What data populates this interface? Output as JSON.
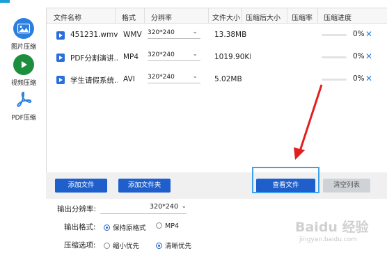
{
  "sidebar": {
    "items": [
      {
        "label": "图片压缩",
        "icon": "image-icon"
      },
      {
        "label": "视频压缩",
        "icon": "video-play-icon"
      },
      {
        "label": "PDF压缩",
        "icon": "pdf-icon"
      }
    ]
  },
  "table": {
    "headers": [
      "文件名称",
      "格式",
      "分辨率",
      "文件大小",
      "压缩后大小",
      "压缩率",
      "压缩进度"
    ],
    "rows": [
      {
        "name": "451231.wmv",
        "format": "WMV",
        "resolution": "320*240",
        "size": "13.38MB",
        "progress": 0,
        "progress_text": "0%"
      },
      {
        "name": "PDF分割演讲...",
        "format": "MP4",
        "resolution": "320*240",
        "size": "1019.90KE",
        "progress": 0,
        "progress_text": "0%"
      },
      {
        "name": "学生请假系统...",
        "format": "AVI",
        "resolution": "320*240",
        "size": "5.02MB",
        "progress": 0,
        "progress_text": "0%"
      }
    ]
  },
  "buttons": {
    "add_file": "添加文件",
    "add_folder": "添加文件夹",
    "view_file": "查看文件",
    "clear_list": "清空列表"
  },
  "settings": {
    "output_resolution_label": "输出分辨率:",
    "output_resolution_value": "320*240",
    "output_format_label": "输出格式:",
    "format_options": [
      "保持原格式",
      "MP4"
    ],
    "compress_label": "压缩选项:",
    "compress_options": [
      "缩小优先",
      "清晰优先"
    ]
  },
  "watermark": {
    "text": "Baidu 经验",
    "sub": "jingyan.baidu.com"
  },
  "colors": {
    "accent": "#1f5fcc",
    "highlight": "#3aa0f0",
    "arrow": "#e02020"
  }
}
